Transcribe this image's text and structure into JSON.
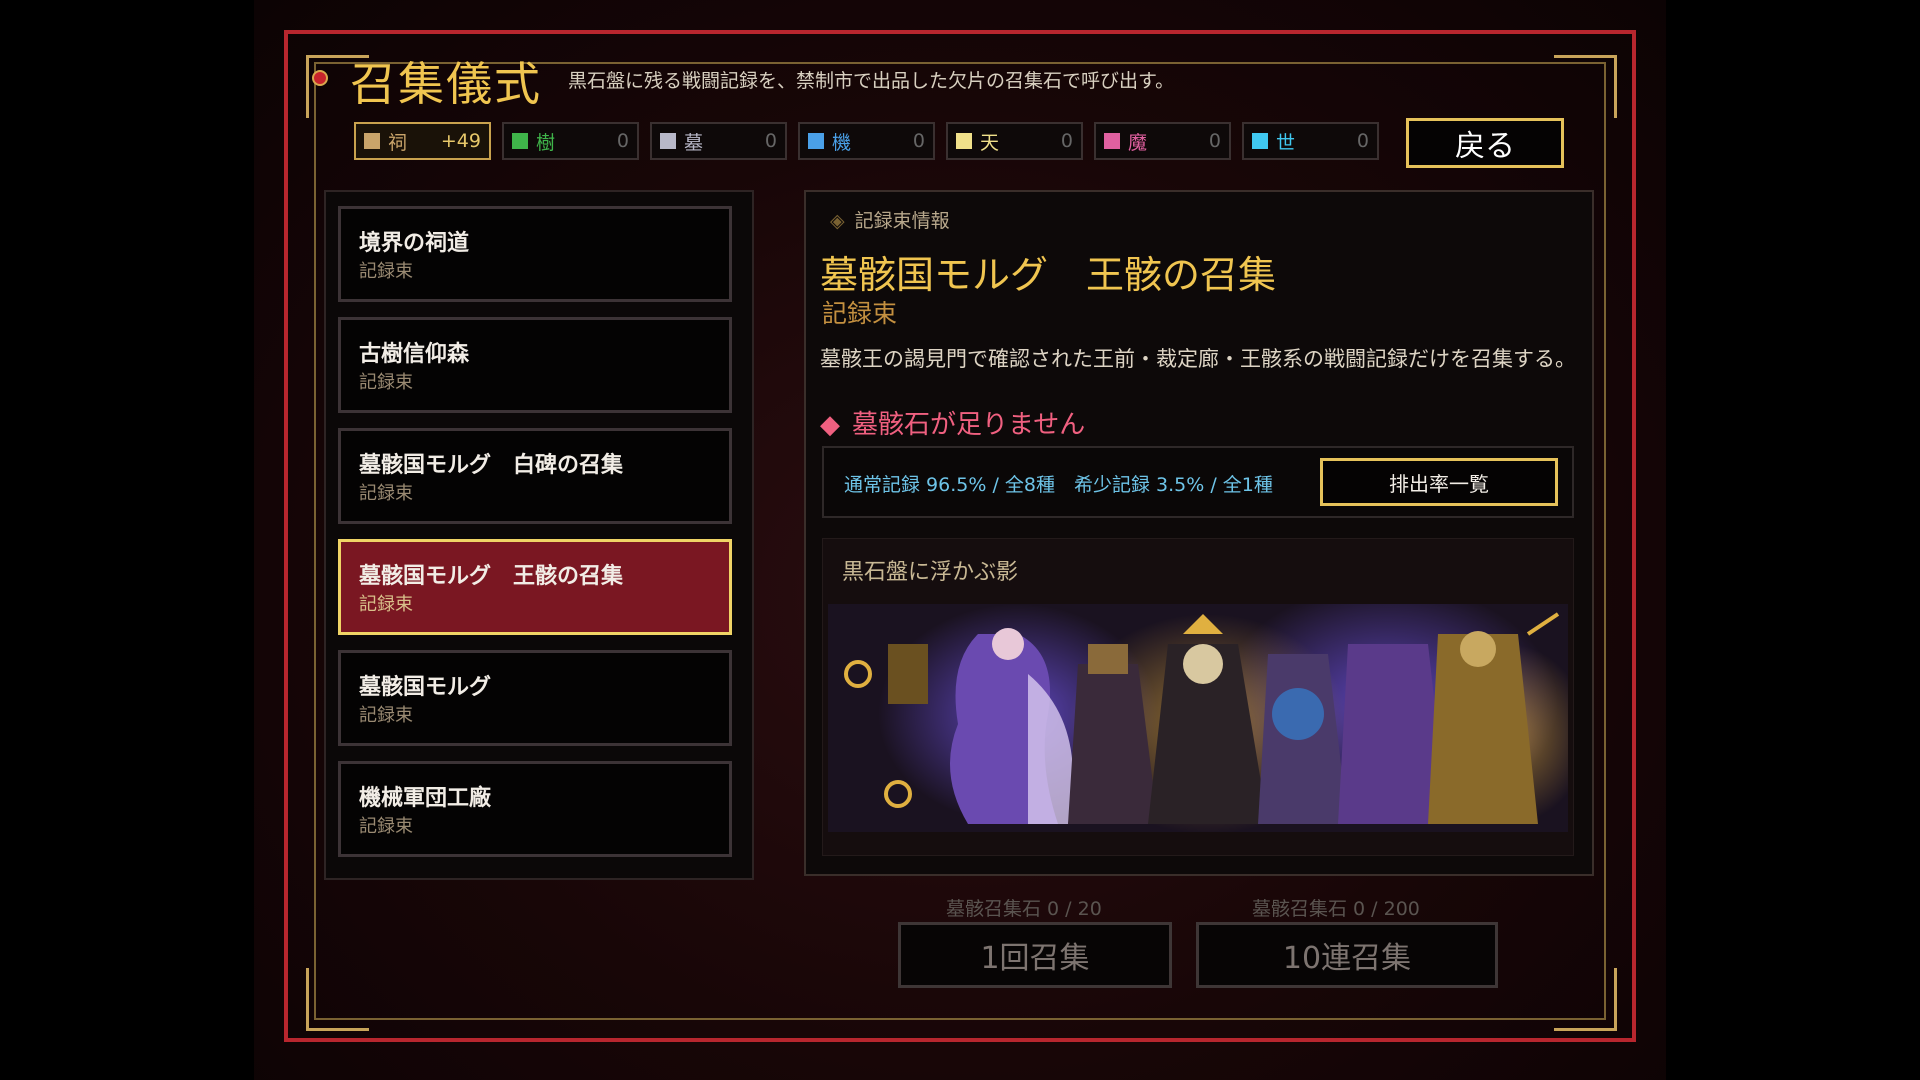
{
  "header": {
    "title": "召集儀式",
    "subtitle": "黒石盤に残る戦闘記録を、禁制市で出品した欠片の召集石で呼び出す。",
    "back_label": "戻る"
  },
  "currencies": [
    {
      "name": "祠",
      "value": "+49",
      "color": "#c9a46a",
      "active": true
    },
    {
      "name": "樹",
      "value": "0",
      "color": "#3fb44a",
      "active": false
    },
    {
      "name": "墓",
      "value": "0",
      "color": "#b8b8c8",
      "active": false
    },
    {
      "name": "機",
      "value": "0",
      "color": "#4aa0e8",
      "active": false
    },
    {
      "name": "天",
      "value": "0",
      "color": "#f0e08a",
      "active": false
    },
    {
      "name": "魔",
      "value": "0",
      "color": "#e060a0",
      "active": false
    },
    {
      "name": "世",
      "value": "0",
      "color": "#40c8f0",
      "active": false
    }
  ],
  "list": [
    {
      "name": "境界の祠道",
      "sub": "記録束"
    },
    {
      "name": "古樹信仰森",
      "sub": "記録束"
    },
    {
      "name": "墓骸国モルグ　白碑の召集",
      "sub": "記録束"
    },
    {
      "name": "墓骸国モルグ　王骸の召集",
      "sub": "記録束",
      "selected": true
    },
    {
      "name": "墓骸国モルグ",
      "sub": "記録束"
    },
    {
      "name": "機械軍団工廠",
      "sub": "記録束"
    }
  ],
  "detail": {
    "label": "記録束情報",
    "title": "墓骸国モルグ　王骸の召集",
    "type": "記録束",
    "description": "墓骸王の謁見門で確認された王前・裁定廊・王骸系の戦闘記録だけを召集する。",
    "warning": "墓骸石が足りません",
    "rates": "通常記録 96.5% / 全8種　希少記録 3.5% / 全1種",
    "rates_button": "排出率一覧",
    "banner_caption": "黒石盤に浮かぶ影"
  },
  "summon": {
    "single_cost": "墓骸召集石 0 / 20",
    "single_label": "1回召集",
    "multi_cost": "墓骸召集石 0 / 200",
    "multi_label": "10連召集"
  }
}
